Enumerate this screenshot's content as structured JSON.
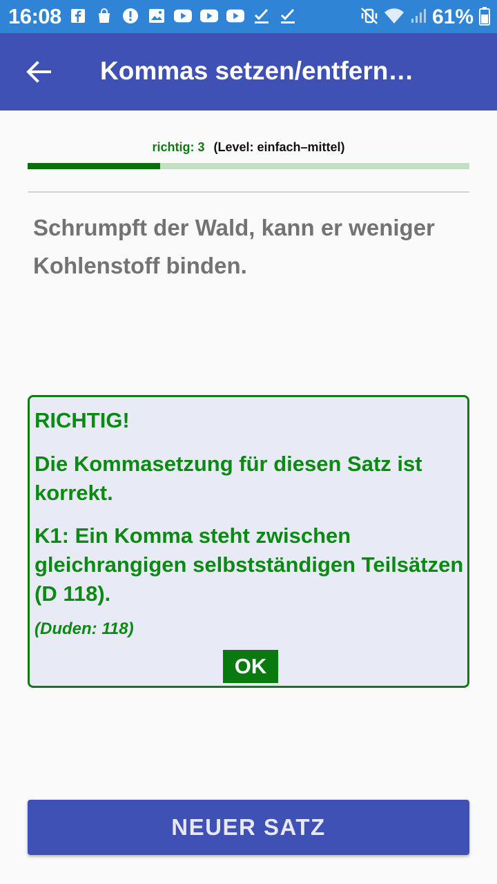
{
  "status_bar": {
    "time": "16:08",
    "left_icons": [
      "facebook-icon",
      "shopping-bag-icon",
      "alert-icon",
      "image-icon",
      "youtube-icon",
      "youtube-icon",
      "youtube-icon",
      "check-icon",
      "check-icon"
    ],
    "right_icons": [
      "mute-vibrate-icon",
      "wifi-icon",
      "signal-icon"
    ],
    "battery_percent": "61%"
  },
  "app_bar": {
    "title": "Kommas setzen/entfern…",
    "color": "#3f51b5"
  },
  "progress": {
    "correct_label": "richtig: 3",
    "level_label": "(Level: einfach–mittel)",
    "fraction": 0.3
  },
  "sentence": "Schrumpft der Wald, kann er weniger Kohlenstoff binden.",
  "result": {
    "title": "RICHTIG!",
    "message": "Die Kommasetzung für diesen Satz ist korrekt.",
    "rule": "K1: Ein Komma steht zwischen gleichrangigen selbstständigen Teilsätzen (D 118).",
    "reference": "(Duden: 118)",
    "ok_label": "OK",
    "accent": "#0a8a12"
  },
  "new_sentence_button": "NEUER SATZ"
}
